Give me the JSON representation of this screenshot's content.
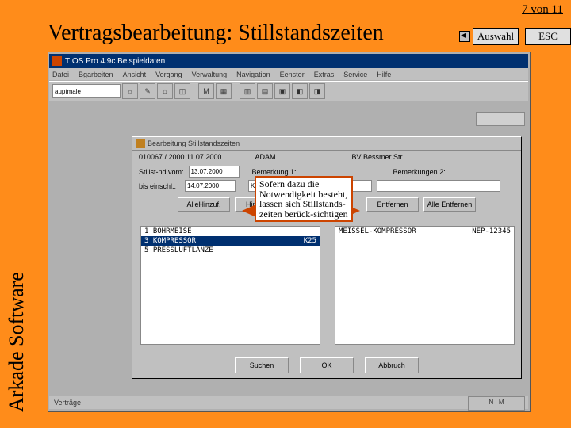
{
  "page": {
    "counter": "7 von 11",
    "auswahl": "Auswahl",
    "esc": "ESC"
  },
  "title": "Vertragsbearbeitung:   Stillstandszeiten",
  "brand": "Arkade Software",
  "app": {
    "title": "TIOS Pro 4.9c   Beispieldaten",
    "menu": [
      "Datei",
      "Bgarbeiten",
      "Ansicht",
      "Vorgang",
      "Verwaltung",
      "Navigation",
      "Eenster",
      "Extras",
      "Service",
      "Hilfe"
    ],
    "dropdown": "auptmale",
    "status_left": "Verträge",
    "status_right": "N I M"
  },
  "dlg": {
    "title": "Bearbeitung Stillstandszeiten",
    "id": "010067 / 2000   11.07.2000",
    "user": "ADAM",
    "bv": "BV Bessmer Str.",
    "from_lbl": "Stillst-nd vom:",
    "from_val": "13.07.2000",
    "till_lbl": "bis einschl.:",
    "till_val": "14.07.2000",
    "bem1_lbl": "Bemerkung 1:",
    "bem1_val": "Kompressor defekt",
    "bem2_lbl": "Bemerkungen 2:",
    "bem2_val": "",
    "btns": [
      "AlleHinzuf.",
      "Hinzufüg.",
      "Entfernen",
      "Alle Entfernen"
    ],
    "left_list": [
      "1 BOHRMEISE",
      "3 KOMPRESSOR",
      "5 PRESSLUFTLANZE"
    ],
    "left_codes": [
      "",
      "K25",
      ""
    ],
    "right_list": [
      "MEISSEL-KOMPRESSOR",
      "",
      ""
    ],
    "right_codes": [
      "NEP-12345",
      "",
      ""
    ],
    "bottom": [
      "Suchen",
      "OK",
      "Abbruch"
    ]
  },
  "callout": "Sofern dazu die Notwendigkeit besteht, lassen sich Stillstands-zeiten berück-sichtigen"
}
